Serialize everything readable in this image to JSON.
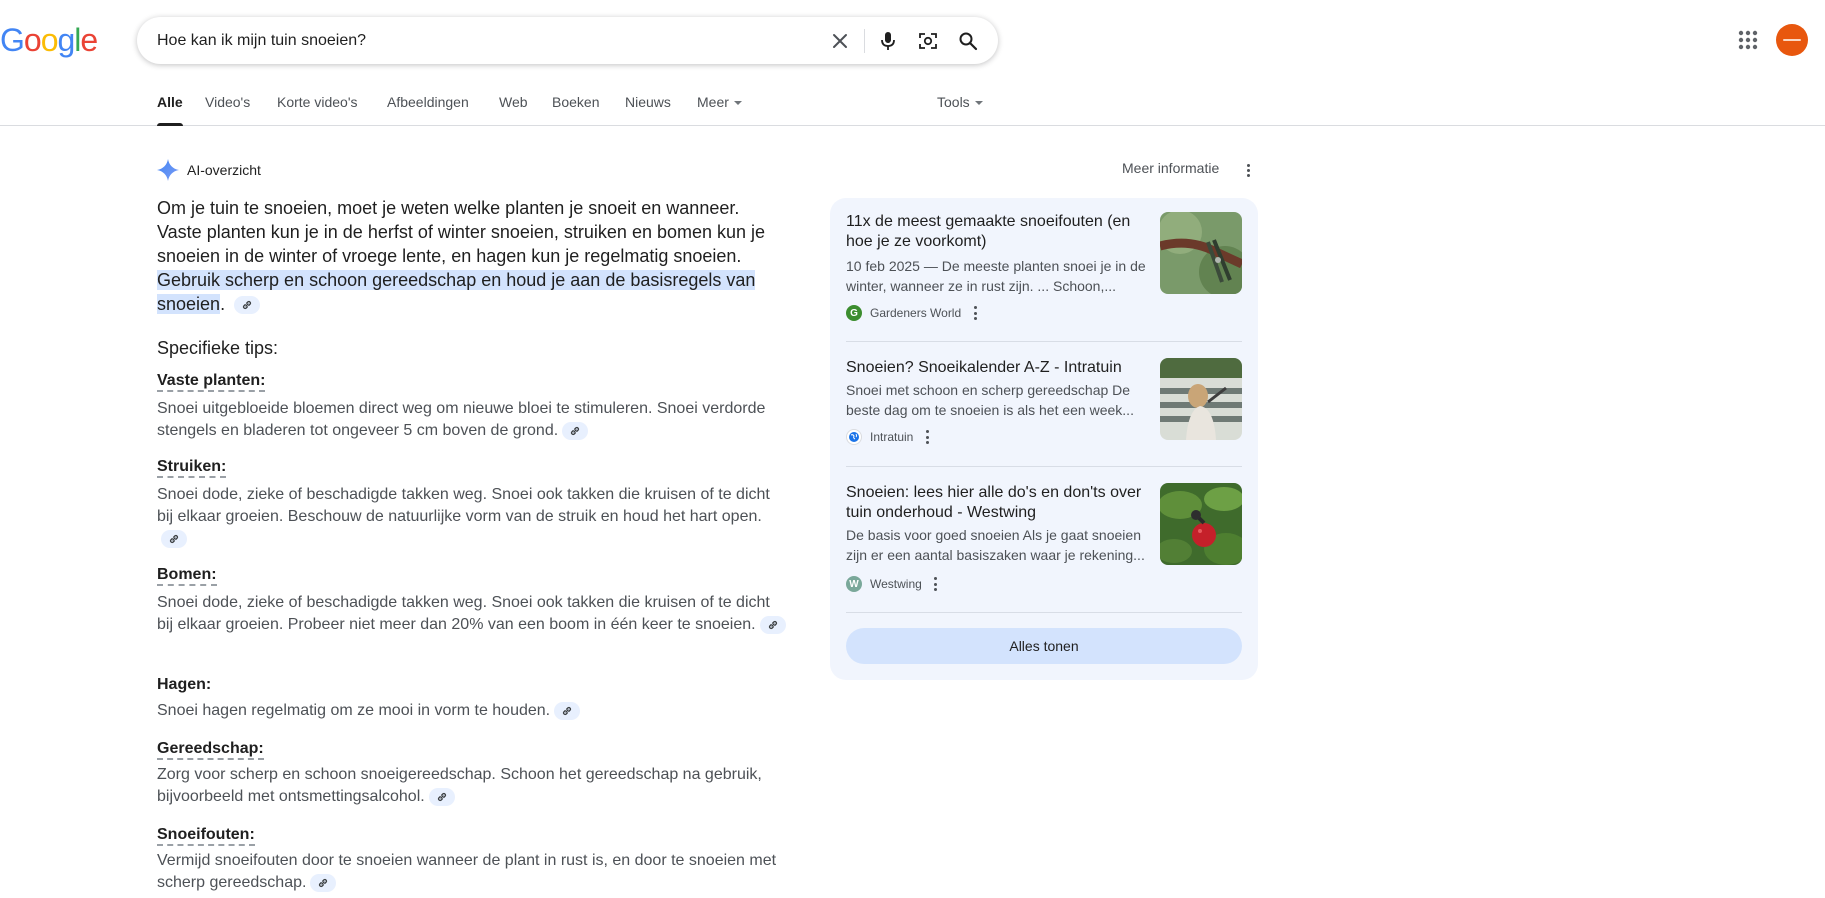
{
  "logo": {
    "text": "Google"
  },
  "search": {
    "query": "Hoe kan ik mijn tuin snoeien?"
  },
  "tabs": [
    {
      "label": "Alle"
    },
    {
      "label": "Video's"
    },
    {
      "label": "Korte video's"
    },
    {
      "label": "Afbeeldingen"
    },
    {
      "label": "Web"
    },
    {
      "label": "Boeken"
    },
    {
      "label": "Nieuws"
    },
    {
      "label": "Meer"
    }
  ],
  "tools_label": "Tools",
  "ai_overview": {
    "title": "AI-overzicht",
    "more_info": "Meer informatie",
    "intro": "Om je tuin te snoeien, moet je weten welke planten je snoeit en wanneer. Vaste planten kun je in de herfst of winter snoeien, struiken en bomen kun je snoeien in de winter of vroege lente, en hagen kun je regelmatig snoeien.",
    "highlight": "Gebruik scherp en schoon gereedschap en houd je aan de basisregels van snoeien",
    "highlight_end": ".",
    "subheading": "Specifieke tips:",
    "tips": [
      {
        "title": "Vaste planten:",
        "body": "Snoei uitgebloeide bloemen direct weg om nieuwe bloei te stimuleren. Snoei verdorde stengels en bladeren tot ongeveer 5 cm boven de grond."
      },
      {
        "title": "Struiken:",
        "body": "Snoei dode, zieke of beschadigde takken weg. Snoei ook takken die kruisen of te dicht bij elkaar groeien. Beschouw de natuurlijke vorm van de struik en houd het hart open."
      },
      {
        "title": "Bomen:",
        "body": "Snoei dode, zieke of beschadigde takken weg. Snoei ook takken die kruisen of te dicht bij elkaar groeien. Probeer niet meer dan 20% van een boom in één keer te snoeien."
      },
      {
        "title": "Hagen:",
        "body": "Snoei hagen regelmatig om ze mooi in vorm te houden."
      },
      {
        "title": "Gereedschap:",
        "body": "Zorg voor scherp en schoon snoeigereedschap. Schoon het gereedschap na gebruik, bijvoorbeeld met ontsmettingsalcohol."
      },
      {
        "title": "Snoeifouten:",
        "body": "Vermijd snoeifouten door te snoeien wanneer de plant in rust is, en door te snoeien met scherp gereedschap."
      }
    ]
  },
  "sources": [
    {
      "title": "11x de meest gemaakte snoeifouten (en hoe je ze voorkomt)",
      "snippet": "10 feb 2025 — De meeste planten snoei je in de winter, wanneer ze in rust zijn. ... Schoon,...",
      "site": "Gardeners World",
      "favicon_letter": "G",
      "favicon_color": "#3c8d2f"
    },
    {
      "title": "Snoeien? Snoeikalender A-Z - Intratuin",
      "snippet": "Snoei met schoon en scherp gereedschap De beste dag om te snoeien is als het een week...",
      "site": "Intratuin",
      "favicon_letter": "",
      "favicon_color": "#1a73e8"
    },
    {
      "title": "Snoeien: lees hier alle do's en don'ts over tuin onderhoud - Westwing",
      "snippet": "De basis voor goed snoeien Als je gaat snoeien zijn er een aantal basiszaken waar je rekening...",
      "site": "Westwing",
      "favicon_letter": "W",
      "favicon_color": "#7aa89a"
    }
  ],
  "show_all_label": "Alles tonen",
  "colors": {
    "accent": "#1a73e8",
    "highlight": "#d3e3fd",
    "panel": "#f1f5fd",
    "avatar": "#e8570e"
  }
}
